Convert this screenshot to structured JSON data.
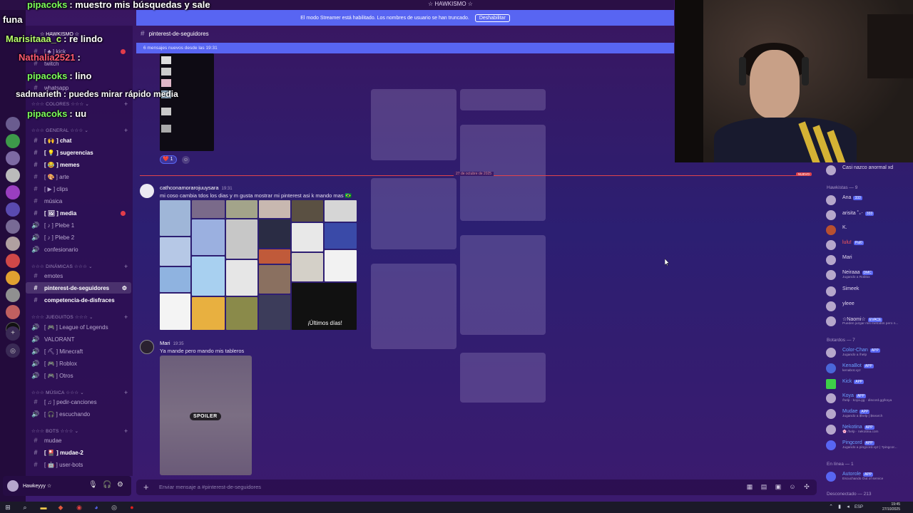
{
  "window": {
    "title": "☆ HAWKISMO ☆"
  },
  "streamer_banner": {
    "text": "El modo Streamer está habilitado. Los nombres de usuario se han truncado.",
    "button": "Deshabilitar"
  },
  "twitch_chat": [
    {
      "user": "pipacoks",
      "text": ": muestro mis búsquedas y sale",
      "color": "#7dff5a"
    },
    {
      "user": "funa",
      "text": "",
      "color": "#ffffff"
    },
    {
      "user": "Marisitaaa_c",
      "text": ": re lindo",
      "color": "#b7ff6a"
    },
    {
      "user": "Nathalia2521",
      "text": ":",
      "color": "#ff5a6e"
    },
    {
      "user": "pipacoks",
      "text": ": lino",
      "color": "#7dff5a"
    },
    {
      "user": "sadmarieth",
      "text": ": puedes mirar rápido media",
      "color": "#ffffff"
    },
    {
      "user": "pipacoks",
      "text": ": uu",
      "color": "#7dff5a"
    }
  ],
  "server": {
    "name": "☆ HAWKISMO ☆"
  },
  "sidebar": {
    "top_channels": [
      {
        "sym": "#",
        "label": "[ ♣ ] kick",
        "bold": false
      },
      {
        "sym": "#",
        "label": "twitch",
        "bold": false
      },
      {
        "sym": "#",
        "label": "whatsapp",
        "bold": false
      }
    ],
    "categories": [
      {
        "label": "☆☆☆ COLORES ☆☆☆ ⌄"
      },
      {
        "label": "☆☆☆ GENERAL ☆☆☆ ⌄"
      },
      {
        "label": "☆☆☆ DINÁMICAS ☆☆☆ ⌄"
      },
      {
        "label": "☆☆☆ JUEGUITOS ☆☆☆ ⌄"
      },
      {
        "label": "☆☆☆ MÚSICA ☆☆☆ ⌄"
      },
      {
        "label": "☆☆☆ BOTS ☆☆☆ ⌄"
      }
    ],
    "general": [
      {
        "sym": "#",
        "label": "[ 🙌 ] chat",
        "bold": true
      },
      {
        "sym": "#",
        "label": "[ 💡 ] sugerencias",
        "bold": true
      },
      {
        "sym": "#",
        "label": "[ 😂 ] memes",
        "bold": true
      },
      {
        "sym": "#",
        "label": "[ 🎨 ] arte",
        "bold": false
      },
      {
        "sym": "#",
        "label": "[ ▶ ] clips",
        "bold": false
      },
      {
        "sym": "#",
        "label": "música",
        "bold": false
      },
      {
        "sym": "#",
        "label": "[ 🖼 ] media",
        "bold": true
      },
      {
        "sym": "🔊",
        "label": "[ ♪ ] Plebe 1",
        "bold": false
      },
      {
        "sym": "🔊",
        "label": "[ ♪ ] Plebe 2",
        "bold": false
      },
      {
        "sym": "🔊",
        "label": "confesionario",
        "bold": false
      }
    ],
    "dinamicas": [
      {
        "sym": "#",
        "label": "emotes",
        "bold": false
      },
      {
        "sym": "#",
        "label": "pinterest-de-seguidores",
        "bold": true,
        "active": true
      },
      {
        "sym": "#",
        "label": "competencia-de-disfraces",
        "bold": true
      }
    ],
    "jueguitos": [
      {
        "sym": "🔊",
        "label": "[ 🎮 ] League of Legends"
      },
      {
        "sym": "🔊",
        "label": "VALORANT"
      },
      {
        "sym": "🔊",
        "label": "[ ⛏ ] Minecraft"
      },
      {
        "sym": "🔊",
        "label": "[ 🎮 ] Roblox"
      },
      {
        "sym": "🔊",
        "label": "[ 🎮 ] Otros"
      }
    ],
    "musica": [
      {
        "sym": "#",
        "label": "[ ♫ ] pedir-canciones"
      },
      {
        "sym": "🔊",
        "label": "[ 🎧 ] escuchando"
      }
    ],
    "bots": [
      {
        "sym": "#",
        "label": "mudae",
        "bold": false
      },
      {
        "sym": "#",
        "label": "[ 🎴 ] mudae-2",
        "bold": true
      },
      {
        "sym": "#",
        "label": "[ 🤖 ] user-bots",
        "bold": false
      }
    ]
  },
  "user_panel": {
    "name": "Hawkeyyy ☆"
  },
  "channel_header": {
    "name": "pinterest-de-seguidores"
  },
  "new_messages_bar": "6 mensajes nuevos desde las 19:31",
  "reaction": {
    "emoji": "❤️",
    "count": "1"
  },
  "date_divider": {
    "text": "27 de octubre de 2025",
    "new_label": "NUEVO"
  },
  "messages": [
    {
      "author": "cathconamorarojuuysara",
      "time": "19:31",
      "text": "mi coso cambia tdos los dias y m gusta mostrar mi pinterest asi k mando mas 🇧🇷",
      "grid_caption": "¡Últimos días!"
    },
    {
      "author": "Mari",
      "time": "19:35",
      "text": "Ya mande pero mando mis tableros",
      "spoiler": "SPOILER"
    }
  ],
  "composer": {
    "placeholder": "Enviar mensaje a #pinterest-de-seguidores"
  },
  "members": {
    "top": {
      "name": "Casi nazco anormal xd"
    },
    "groups": [
      {
        "title": "Hawkistas — 9",
        "items": [
          {
            "name": "Ana",
            "tag": "333",
            "status": ""
          },
          {
            "name": "arisita ˚₊‧",
            "tag": "333",
            "status": ""
          },
          {
            "name": "K.",
            "tag": "",
            "status": ""
          },
          {
            "name": "lulu!",
            "tag": "Pal0",
            "status": ""
          },
          {
            "name": "Mari",
            "tag": "",
            "status": ""
          },
          {
            "name": "Neiraaa",
            "tag": "DMC",
            "status": "Jugando a Roblox"
          },
          {
            "name": "Simeek",
            "tag": "",
            "status": ""
          },
          {
            "name": "yleee",
            "tag": "",
            "status": ""
          },
          {
            "name": "☆Naomi☆",
            "tag": "EVACE",
            "status": "Pueden juzgar mis metodos pero n..."
          }
        ]
      },
      {
        "title": "Botardos — 7",
        "items": [
          {
            "name": "Color-Chan",
            "tag": "APP",
            "status": "Jugando a /help"
          },
          {
            "name": "KenaBot",
            "tag": "APP",
            "status": "kenabot.xyz"
          },
          {
            "name": "Kick",
            "tag": "APP",
            "status": ""
          },
          {
            "name": "Koya",
            "tag": "APP",
            "status": "/help · koya.gg · discord.gg/koya"
          },
          {
            "name": "Mudae",
            "tag": "APP",
            "status": "Jugando a $help | $search"
          },
          {
            "name": "Nekotina",
            "tag": "APP",
            "status": "🌸 /help · nekotina.com"
          },
          {
            "name": "Pingcord",
            "tag": "APP",
            "status": "Jugando a pingcord.xyz | ?pingcor..."
          }
        ]
      },
      {
        "title": "En línea — 1",
        "items": [
          {
            "name": "Autorole",
            "tag": "APP",
            "status": "Escuchando Out of service"
          }
        ]
      },
      {
        "title": "Desconectado — 213",
        "items": []
      }
    ]
  },
  "taskbar": {
    "time": "19:45",
    "date": "27/10/2025",
    "lang": "ESP"
  },
  "colors": {
    "accent": "#5865f2",
    "danger": "#e0444c",
    "bg_dark": "#230b3c"
  }
}
